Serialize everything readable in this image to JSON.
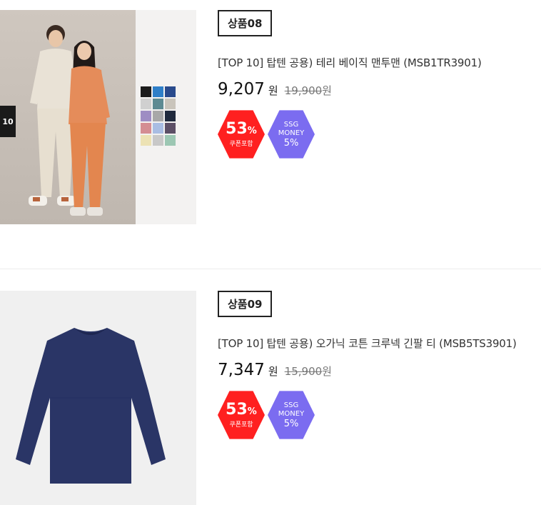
{
  "products": [
    {
      "tag": "상품08",
      "title": "[TOP 10] 탑텐 공용) 테리 베이직 맨투맨 (MSB1TR3901)",
      "price": "9,207",
      "price_unit": "원",
      "original_price": "19,900",
      "original_price_unit": "원",
      "discount": {
        "number": "53",
        "sign": "%",
        "label": "쿠폰포함",
        "color": "#ff2020"
      },
      "ssg_badge": {
        "line1": "SSG",
        "line2": "MONEY",
        "line3": "5%",
        "color": "#7b6cf0"
      },
      "image": {
        "logo_text": "10",
        "swatches": [
          "#1c1c1c",
          "#2e7fc8",
          "#294a8c",
          "#d0d0d0",
          "#5d8a92",
          "#c9c4bb",
          "#9e8dc3",
          "#a8a8a8",
          "#202a3d",
          "#d48d93",
          "#a9bde3",
          "#5c4f66",
          "#ece2b4",
          "#c8c8c8",
          "#9cc7b3"
        ]
      }
    },
    {
      "tag": "상품09",
      "title": "[TOP 10] 탑텐 공용) 오가닉 코튼 크루넥 긴팔 티 (MSB5TS3901)",
      "price": "7,347",
      "price_unit": "원",
      "original_price": "15,900",
      "original_price_unit": "원",
      "discount": {
        "number": "53",
        "sign": "%",
        "label": "쿠폰포함",
        "color": "#ff2020"
      },
      "ssg_badge": {
        "line1": "SSG",
        "line2": "MONEY",
        "line3": "5%",
        "color": "#7b6cf0"
      },
      "image": {
        "shirt_color": "#2a3566"
      }
    }
  ]
}
